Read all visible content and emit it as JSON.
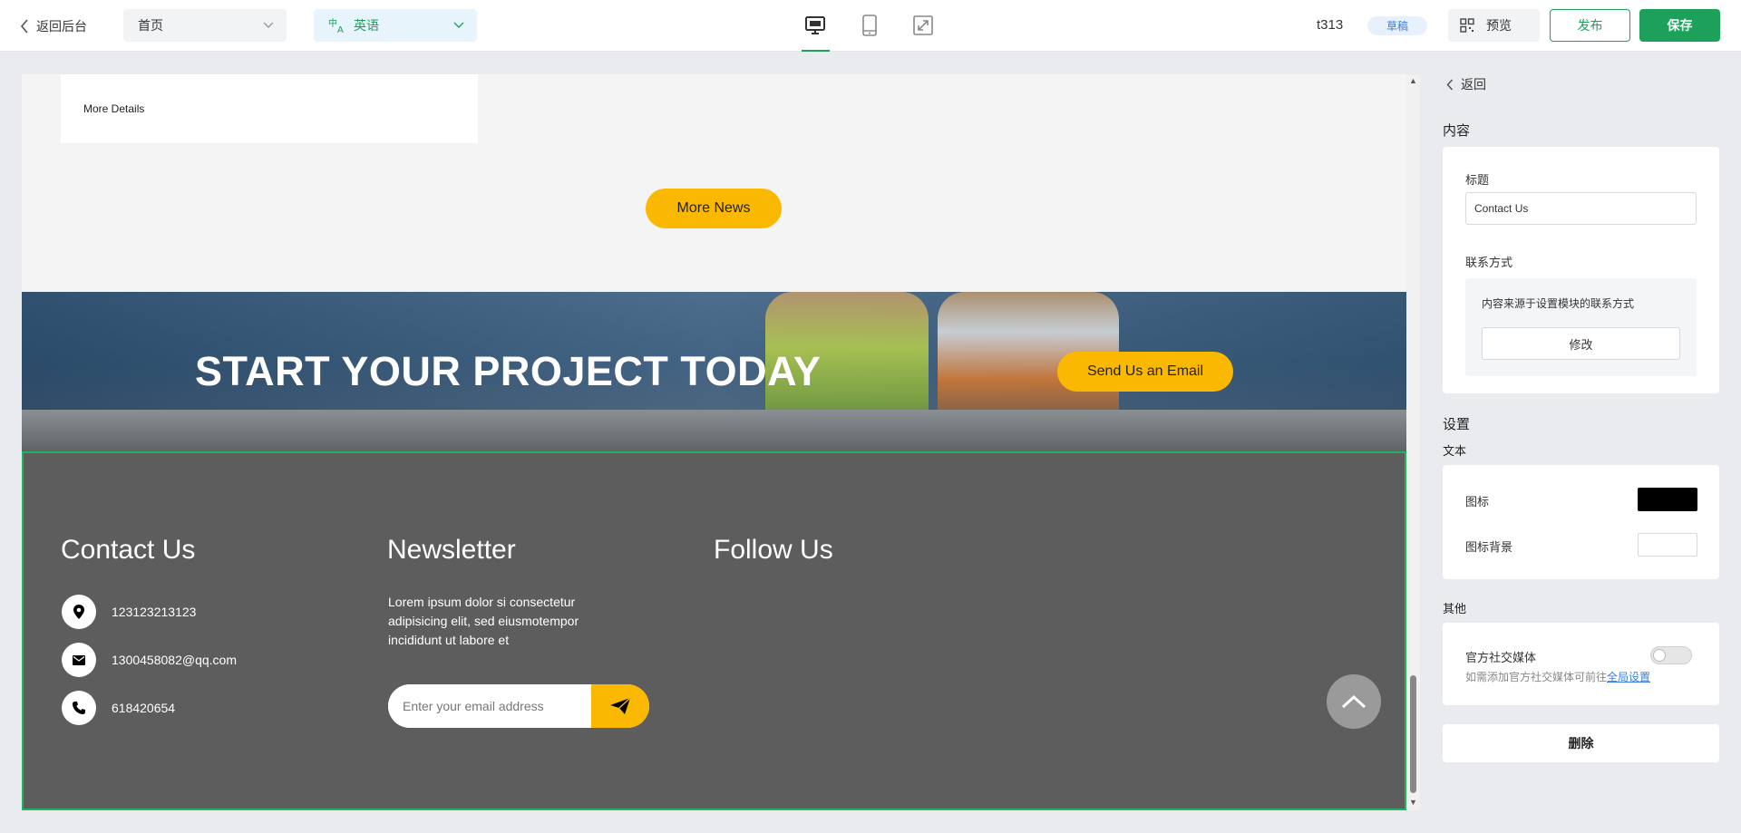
{
  "topbar": {
    "back_label": "返回后台",
    "page_select": "首页",
    "lang_select": "英语",
    "site_name": "t313",
    "status": "草稿",
    "preview": "预览",
    "publish": "发布",
    "save": "保存"
  },
  "canvas": {
    "news_card_link": "More Details",
    "more_news": "More News",
    "cta_title": "START YOUR PROJECT TODAY",
    "cta_button": "Send Us an Email",
    "footer": {
      "contact_title": "Contact Us",
      "newsletter_title": "Newsletter",
      "follow_title": "Follow Us",
      "address": "123123213123",
      "email": "1300458082@qq.com",
      "phone": "618420654",
      "newsletter_text": "Lorem ipsum dolor si consectetur adipisicing elit, sed eiusmotempor incididunt ut labore et",
      "email_placeholder": "Enter your email address"
    }
  },
  "panel": {
    "back_label": "返回",
    "content_section": "内容",
    "title_label": "标题",
    "title_value": "Contact Us",
    "contact_label": "联系方式",
    "contact_note": "内容来源于设置模块的联系方式",
    "edit_button": "修改",
    "settings_section": "设置",
    "text_sub": "文本",
    "icon_label": "图标",
    "icon_bg_label": "图标背景",
    "other_sub": "其他",
    "social_label": "官方社交媒体",
    "hint_prefix": "如需添加官方社交媒体可前往",
    "hint_link": "全局设置",
    "delete_button": "删除"
  },
  "colors": {
    "accent_green": "#1ca05a",
    "brand_yellow": "#fbb800",
    "footer_bg": "#5d5d5d",
    "icon_color": "#000000",
    "icon_bg_color": "#ffffff"
  },
  "icons": [
    "chevron-left-icon",
    "chevron-down-icon",
    "translate-icon",
    "desktop-icon",
    "tablet-icon",
    "fullscreen-icon",
    "qr-code-icon",
    "location-icon",
    "mail-icon",
    "phone-icon",
    "send-icon",
    "chevron-up-icon"
  ]
}
